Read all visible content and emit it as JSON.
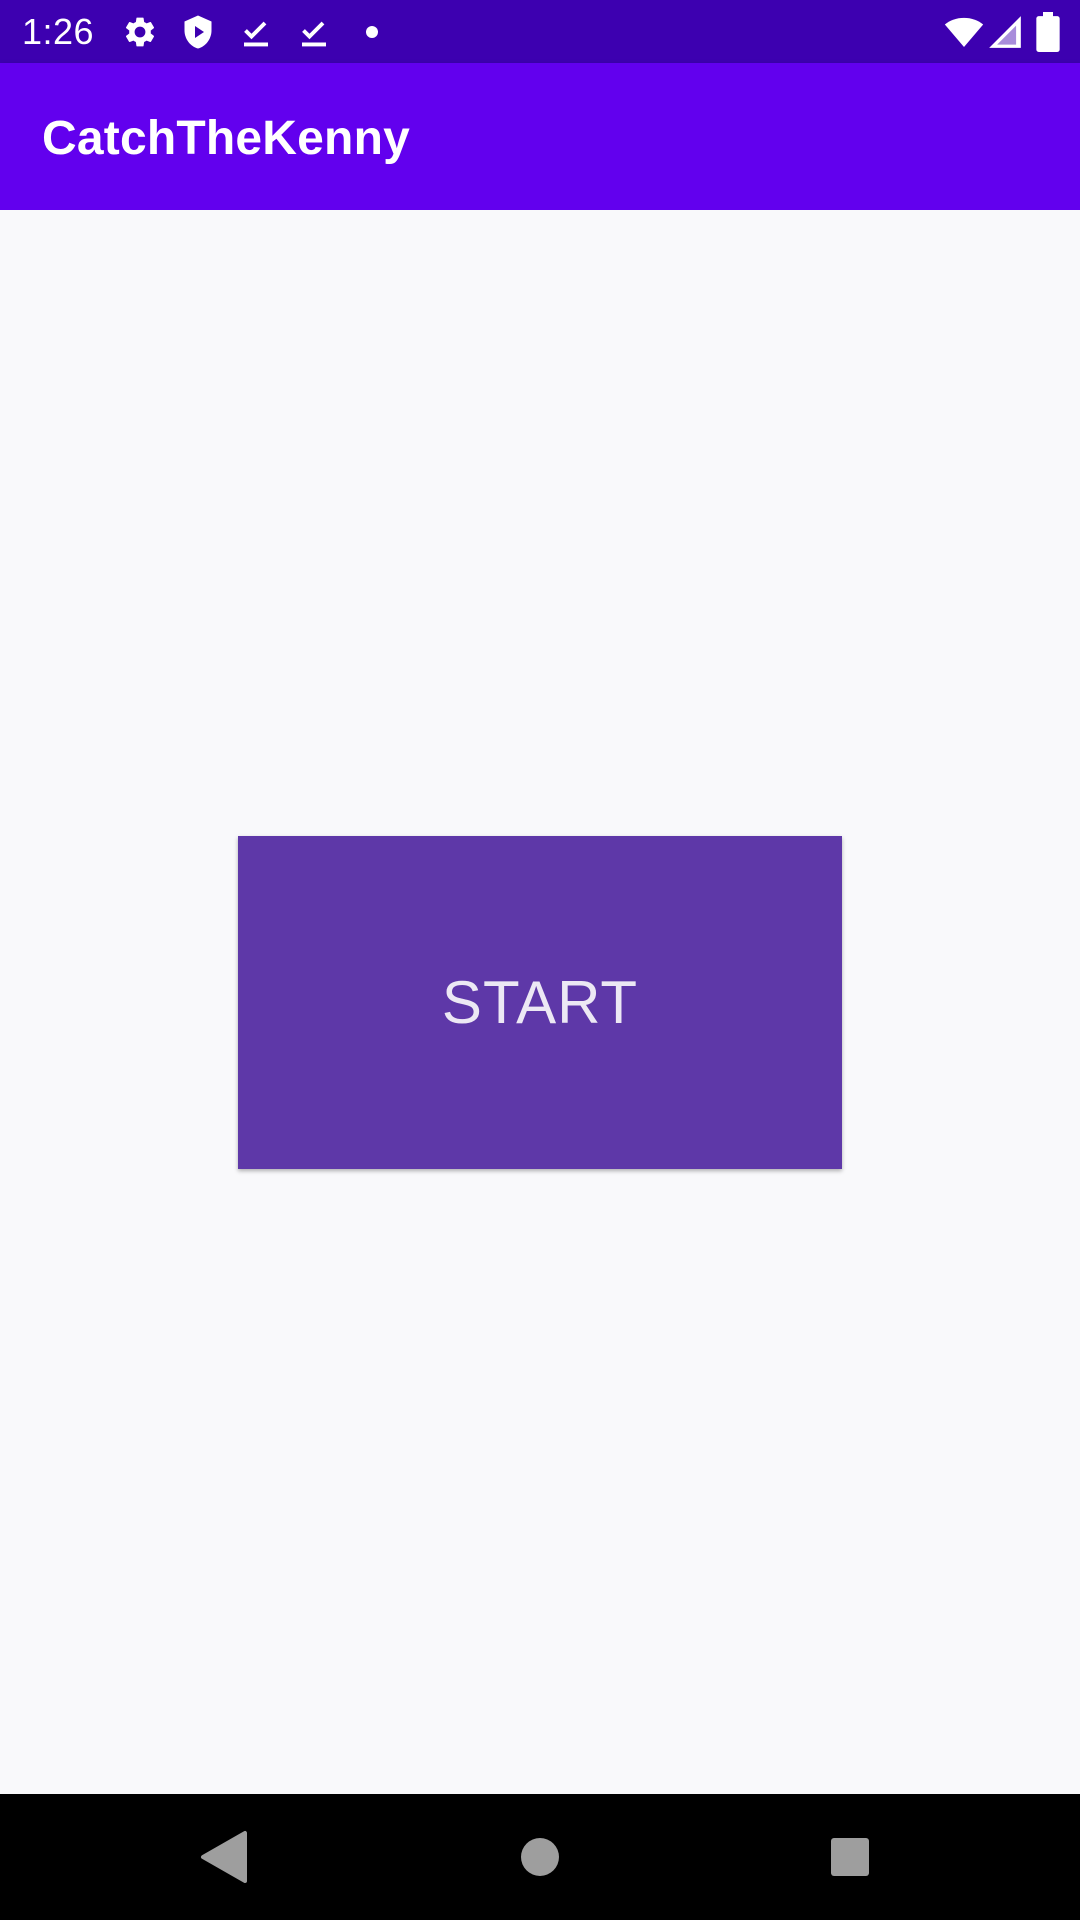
{
  "status_bar": {
    "time": "1:26",
    "background": "#3d00b0",
    "left_icons": [
      "gear-icon",
      "shield-play-icon",
      "download-done-icon",
      "download-done-icon",
      "dot-icon"
    ],
    "right_icons": [
      "wifi-icon",
      "signal-icon",
      "battery-icon"
    ]
  },
  "app_bar": {
    "title": "CatchTheKenny",
    "background": "#6200ee"
  },
  "main": {
    "start_button_label": "START",
    "button_color": "#5e38a8"
  },
  "nav_bar": {
    "buttons": [
      "back-icon",
      "home-icon",
      "recents-icon"
    ]
  }
}
